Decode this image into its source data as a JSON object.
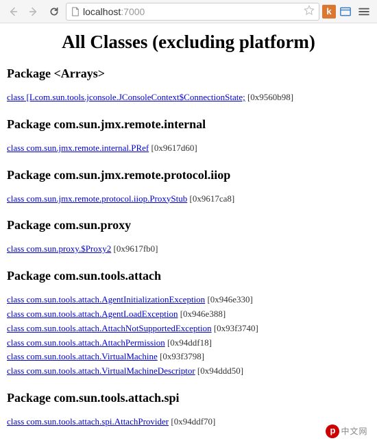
{
  "browser": {
    "url_host": "localhost",
    "url_port": ":7000",
    "ext_k_label": "k"
  },
  "page": {
    "title": "All Classes (excluding platform)"
  },
  "packages": [
    {
      "heading": "Package <Arrays>",
      "classes": [
        {
          "link": "class [Lcom.sun.tools.jconsole.JConsoleContext$ConnectionState;",
          "addr": "[0x9560b98]"
        }
      ]
    },
    {
      "heading": "Package com.sun.jmx.remote.internal",
      "classes": [
        {
          "link": "class com.sun.jmx.remote.internal.PRef",
          "addr": "[0x9617d60]"
        }
      ]
    },
    {
      "heading": "Package com.sun.jmx.remote.protocol.iiop",
      "classes": [
        {
          "link": "class com.sun.jmx.remote.protocol.iiop.ProxyStub",
          "addr": "[0x9617ca8]"
        }
      ]
    },
    {
      "heading": "Package com.sun.proxy",
      "classes": [
        {
          "link": "class com.sun.proxy.$Proxy2",
          "addr": "[0x9617fb0]"
        }
      ]
    },
    {
      "heading": "Package com.sun.tools.attach",
      "classes": [
        {
          "link": "class com.sun.tools.attach.AgentInitializationException",
          "addr": "[0x946e330]"
        },
        {
          "link": "class com.sun.tools.attach.AgentLoadException",
          "addr": "[0x946e388]"
        },
        {
          "link": "class com.sun.tools.attach.AttachNotSupportedException",
          "addr": "[0x93f3740]"
        },
        {
          "link": "class com.sun.tools.attach.AttachPermission",
          "addr": "[0x94ddf18]"
        },
        {
          "link": "class com.sun.tools.attach.VirtualMachine",
          "addr": "[0x93f3798]"
        },
        {
          "link": "class com.sun.tools.attach.VirtualMachineDescriptor",
          "addr": "[0x94ddd50]"
        }
      ]
    },
    {
      "heading": "Package com.sun.tools.attach.spi",
      "classes": [
        {
          "link": "class com.sun.tools.attach.spi.AttachProvider",
          "addr": "[0x94ddf70]"
        }
      ]
    }
  ],
  "watermark": {
    "text": "中文网"
  }
}
